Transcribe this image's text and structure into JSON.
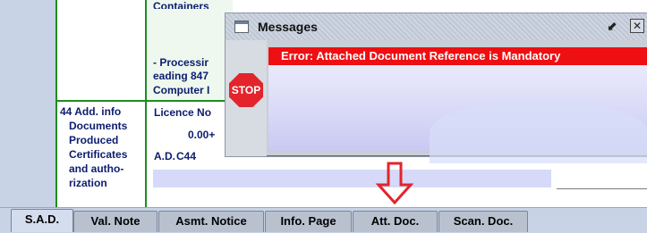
{
  "form": {
    "box43_partial": "Containers",
    "box43_lines": [
      "- Processir",
      "eading 847",
      "Computer I"
    ],
    "box44_label_lines": [
      "44 Add. info",
      "Documents",
      "Produced",
      "Certificates",
      "and autho-",
      "rization"
    ],
    "licence_label": "Licence No",
    "licence_value": "0.00+",
    "ad_label": "A.D.",
    "ad_value": "C44"
  },
  "messages": {
    "title": "Messages",
    "error": "Error: Attached Document Reference is Mandatory",
    "stop_text": "STOP",
    "restore_icon": "restore-icon",
    "close_icon": "close-icon"
  },
  "tabs": [
    {
      "label": "S.A.D.",
      "active": true
    },
    {
      "label": "Val. Note",
      "active": false
    },
    {
      "label": "Asmt. Notice",
      "active": false
    },
    {
      "label": "Info. Page",
      "active": false
    },
    {
      "label": "Att. Doc.",
      "active": false
    },
    {
      "label": "Scan. Doc.",
      "active": false
    }
  ],
  "colors": {
    "error_bg": "#ee0f12",
    "form_line": "#1f8c1f",
    "arrow": "#e3242b"
  }
}
